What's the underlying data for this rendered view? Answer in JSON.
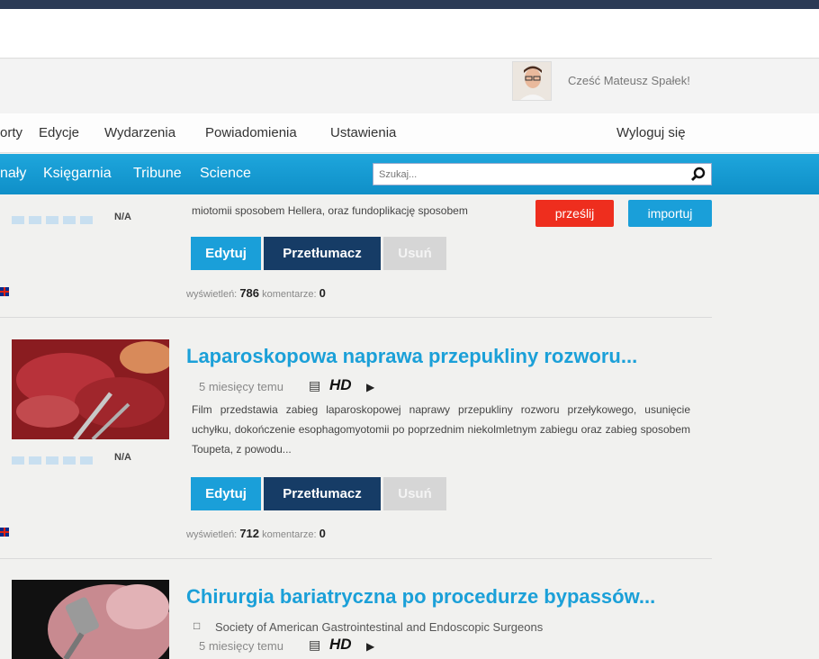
{
  "header": {
    "greeting": "Cześć Mateusz Spałek!",
    "logout_label": "Wyloguj się"
  },
  "main_nav": [
    "orty",
    "Edycje",
    "Wydarzenia",
    "Powiadomienia",
    "Ustawienia"
  ],
  "sub_nav": [
    "nały",
    "Księgarnia",
    "Tribune",
    "Science"
  ],
  "search": {
    "placeholder": "Szukaj..."
  },
  "buttons": {
    "send": "prześlij",
    "import": "importuj",
    "edit": "Edytuj",
    "translate": "Przetłumacz",
    "delete": "Usuń"
  },
  "labels": {
    "views": "wyświetleń:",
    "comments": "komentarze:",
    "rating": "N/A",
    "hd": "HD"
  },
  "videos": [
    {
      "desc": "miotomii sposobem Hellera, oraz fundoplikację sposobem",
      "views": "786",
      "comments": "0"
    },
    {
      "title": "Laparoskopowa naprawa przepukliny rozworu...",
      "age": "5 miesięcy temu",
      "desc": "Film przedstawia zabieg laparoskopowej naprawy przepukliny rozworu przełykowego, usunięcie uchyłku, dokończenie esophagomyotomii po poprzednim niekolmletnym zabiegu oraz zabieg sposobem Toupeta, z powodu...",
      "views": "712",
      "comments": "0"
    },
    {
      "title": "Chirurgia bariatryczna po procedurze bypassów...",
      "org": "Society of American Gastrointestinal and Endoscopic Surgeons",
      "age": "5 miesięcy temu"
    }
  ],
  "colors": {
    "accent": "#1a9fd9",
    "dark_button": "#163c66",
    "send_button": "#ee2e1e"
  }
}
